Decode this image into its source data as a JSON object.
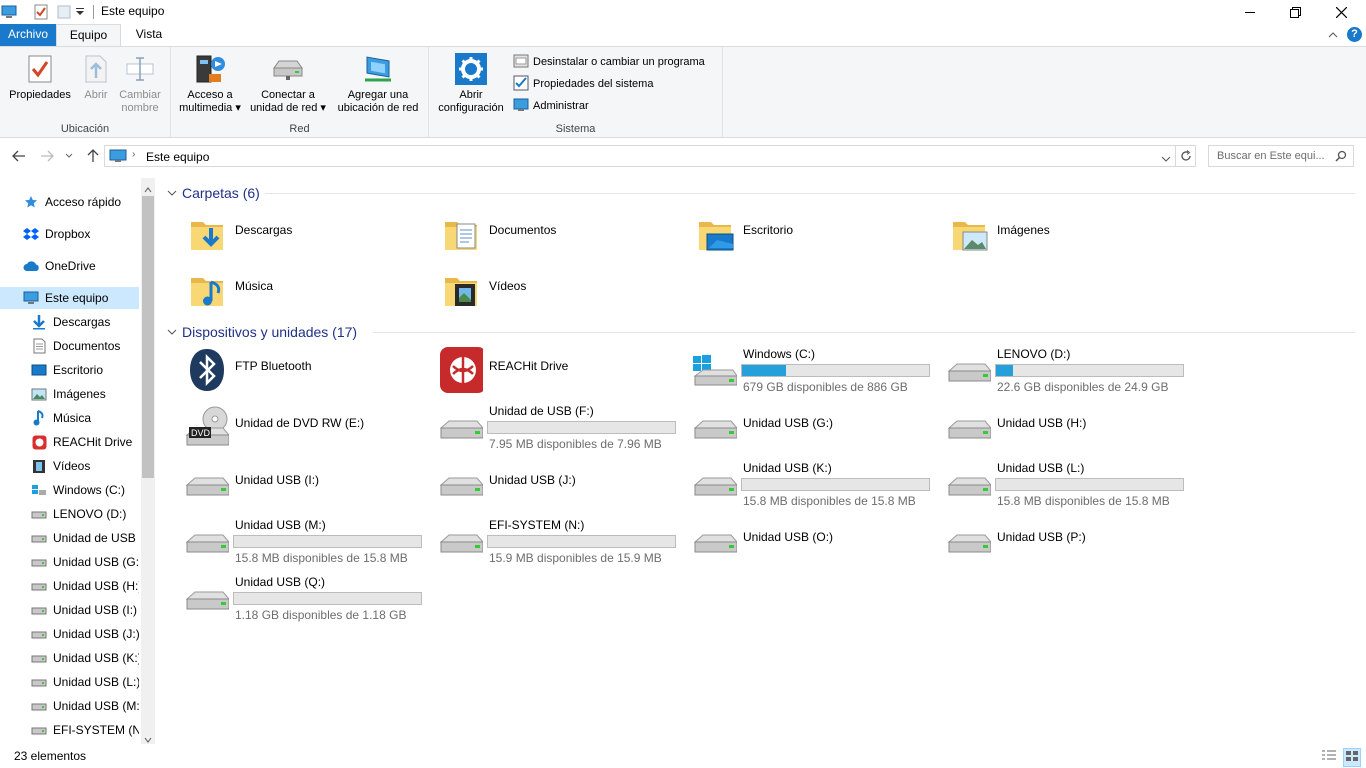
{
  "window": {
    "title": "Este equipo"
  },
  "tabs": {
    "file": "Archivo",
    "computer": "Equipo",
    "view": "Vista"
  },
  "ribbon": {
    "location": {
      "label": "Ubicación",
      "properties": "Propiedades",
      "open": "Abrir",
      "rename1": "Cambiar",
      "rename2": "nombre"
    },
    "network": {
      "label": "Red",
      "media1": "Acceso a",
      "media2": "multimedia",
      "map1": "Conectar a",
      "map2": "unidad de red",
      "add1": "Agregar una",
      "add2": "ubicación de red"
    },
    "system": {
      "label": "Sistema",
      "settings1": "Abrir",
      "settings2": "configuración",
      "uninstall": "Desinstalar o cambiar un programa",
      "sysprops": "Propiedades del sistema",
      "manage": "Administrar"
    }
  },
  "address": {
    "path": "Este equipo",
    "search_placeholder": "Buscar en Este equi..."
  },
  "nav": {
    "items": [
      "Acceso rápido",
      "Dropbox",
      "OneDrive",
      "Este equipo",
      "Descargas",
      "Documentos",
      "Escritorio",
      "Imágenes",
      "Música",
      "REACHit Drive",
      "Vídeos",
      "Windows (C:)",
      "LENOVO (D:)",
      "Unidad de USB (",
      "Unidad USB (G:)",
      "Unidad USB (H:)",
      "Unidad USB (I:)",
      "Unidad USB (J:)",
      "Unidad USB (K:)",
      "Unidad USB (L:)",
      "Unidad USB (M:)",
      "EFI-SYSTEM (N:)"
    ]
  },
  "folders": {
    "header": "Carpetas (6)",
    "items": [
      "Descargas",
      "Documentos",
      "Escritorio",
      "Imágenes",
      "Música",
      "Vídeos"
    ]
  },
  "devices": {
    "header": "Dispositivos y unidades (17)",
    "items": [
      {
        "name": "FTP Bluetooth",
        "icon": "bluetooth-icon"
      },
      {
        "name": "REACHit Drive",
        "icon": "reachit-icon"
      },
      {
        "name": "Windows (C:)",
        "icon": "windows-drive-icon",
        "free": "679 GB disponibles de 886 GB",
        "used": 0.234
      },
      {
        "name": "LENOVO (D:)",
        "icon": "drive-icon",
        "free": "22.6 GB disponibles de 24.9 GB",
        "used": 0.092
      },
      {
        "name": "Unidad de DVD RW (E:)",
        "icon": "dvd-icon"
      },
      {
        "name": "Unidad de USB (F:)",
        "icon": "drive-icon",
        "free": "7.95 MB disponibles de 7.96 MB",
        "used": 0.0
      },
      {
        "name": "Unidad USB (G:)",
        "icon": "drive-icon"
      },
      {
        "name": "Unidad USB (H:)",
        "icon": "drive-icon"
      },
      {
        "name": "Unidad USB (I:)",
        "icon": "drive-icon"
      },
      {
        "name": "Unidad USB (J:)",
        "icon": "drive-icon"
      },
      {
        "name": "Unidad USB (K:)",
        "icon": "drive-icon",
        "free": "15.8 MB disponibles de 15.8 MB",
        "used": 0.0
      },
      {
        "name": "Unidad USB (L:)",
        "icon": "drive-icon",
        "free": "15.8 MB disponibles de 15.8 MB",
        "used": 0.0
      },
      {
        "name": "Unidad USB (M:)",
        "icon": "drive-icon",
        "free": "15.8 MB disponibles de 15.8 MB",
        "used": 0.0
      },
      {
        "name": "EFI-SYSTEM (N:)",
        "icon": "drive-icon",
        "free": "15.9 MB disponibles de 15.9 MB",
        "used": 0.0
      },
      {
        "name": "Unidad USB (O:)",
        "icon": "drive-icon"
      },
      {
        "name": "Unidad USB (P:)",
        "icon": "drive-icon"
      },
      {
        "name": "Unidad USB (Q:)",
        "icon": "drive-icon",
        "free": "1.18 GB disponibles de 1.18 GB",
        "used": 0.0
      }
    ]
  },
  "status": {
    "count": "23 elementos"
  },
  "colors": {
    "accent": "#1979ca",
    "bar_fill": "#26a0da",
    "header": "#1e3287",
    "selection": "#cce8ff"
  }
}
